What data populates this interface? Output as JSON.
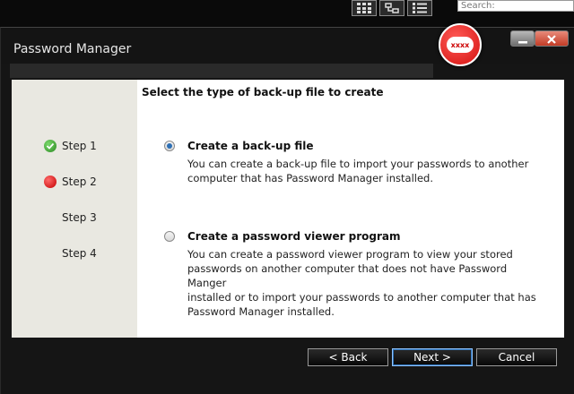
{
  "background": {
    "search_placeholder": "Search:",
    "view_buttons": [
      "grid-view-icon",
      "tree-view-icon",
      "list-view-icon"
    ]
  },
  "window": {
    "title": "Password Manager",
    "badge_text": "xxxx"
  },
  "steps": [
    {
      "label": "Step 1",
      "state": "done"
    },
    {
      "label": "Step 2",
      "state": "active"
    },
    {
      "label": "Step 3",
      "state": "pending"
    },
    {
      "label": "Step 4",
      "state": "pending"
    }
  ],
  "main": {
    "heading": "Select the type of back-up file to create",
    "options": [
      {
        "title": "Create a back-up file",
        "desc_lines": [
          "You can create a back-up file to import your passwords to another",
          "computer that has Password Manager installed."
        ],
        "selected": true
      },
      {
        "title": "Create a password viewer program",
        "desc_lines": [
          "You can create a password viewer program to view your stored",
          "passwords on another computer that does not have Password Manger",
          "installed or to import your passwords to another computer that has",
          "Password Manager installed."
        ],
        "selected": false
      }
    ]
  },
  "buttons": {
    "back": "< Back",
    "next": "Next >",
    "cancel": "Cancel"
  },
  "colors": {
    "step_done": "#2c8a24",
    "step_active": "#c40000",
    "radio_selected": "#2d6fb4"
  }
}
